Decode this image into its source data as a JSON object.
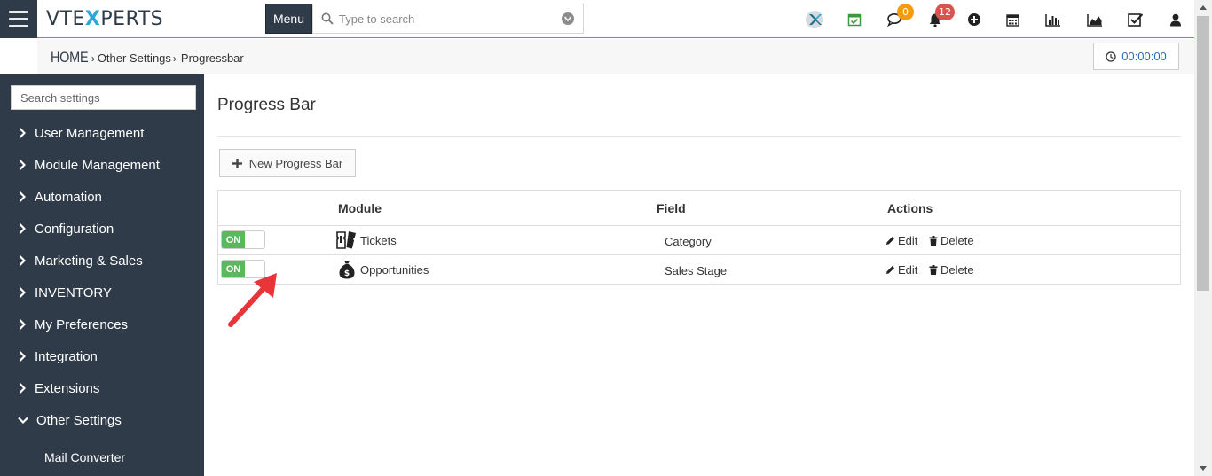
{
  "app": {
    "logo_left": "VTE",
    "logo_x": "X",
    "logo_right": "PERTS"
  },
  "header": {
    "menu_label": "Menu",
    "search_placeholder": "Type to search",
    "comments_count": "0",
    "notifications_count": "12"
  },
  "breadcrumb": {
    "home": "HOME",
    "level1": "Other Settings",
    "level2": "Progressbar"
  },
  "timer": "00:00:00",
  "sidebar": {
    "search_placeholder": "Search settings",
    "items": [
      {
        "label": "User Management"
      },
      {
        "label": "Module Management"
      },
      {
        "label": "Automation"
      },
      {
        "label": "Configuration"
      },
      {
        "label": "Marketing & Sales"
      },
      {
        "label": "INVENTORY"
      },
      {
        "label": "My Preferences"
      },
      {
        "label": "Integration"
      },
      {
        "label": "Extensions"
      },
      {
        "label": "Other Settings"
      }
    ],
    "sub_items": [
      {
        "label": "Mail Converter"
      }
    ]
  },
  "main": {
    "title": "Progress Bar",
    "new_button": "New Progress Bar",
    "columns": {
      "module": "Module",
      "field": "Field",
      "actions": "Actions"
    },
    "rows": [
      {
        "status": "ON",
        "module": "Tickets",
        "field": "Category",
        "edit": "Edit",
        "delete": "Delete"
      },
      {
        "status": "ON",
        "module": "Opportunities",
        "field": "Sales Stage",
        "edit": "Edit",
        "delete": "Delete"
      }
    ]
  },
  "colors": {
    "accent": "#e8692b",
    "sidebar": "#2f3b49",
    "toggle_on": "#5cb85c",
    "badge_orange": "#f39c12",
    "badge_red": "#d9534f",
    "arrow": "#e8353a"
  }
}
